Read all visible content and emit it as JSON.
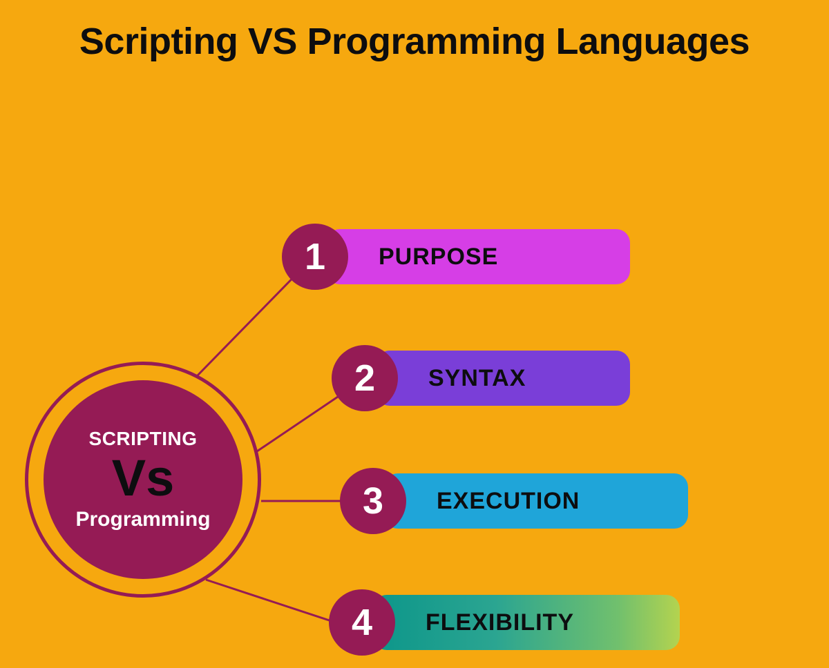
{
  "title": "Scripting VS Programming Languages",
  "hub": {
    "line1": "SCRIPTING",
    "line2": "Vs",
    "line3": "Programming"
  },
  "items": [
    {
      "num": "1",
      "label": "PURPOSE"
    },
    {
      "num": "2",
      "label": "SYNTAX"
    },
    {
      "num": "3",
      "label": "EXECUTION"
    },
    {
      "num": "4",
      "label": "FLEXIBILITY"
    }
  ],
  "colors": {
    "background": "#f6a80f",
    "hub": "#951b55",
    "pill1": "#d63ee6",
    "pill2": "#7a3ed8",
    "pill3": "#1fa5d9",
    "pill4_start": "#0c968a",
    "pill4_end": "#b4d34f"
  }
}
